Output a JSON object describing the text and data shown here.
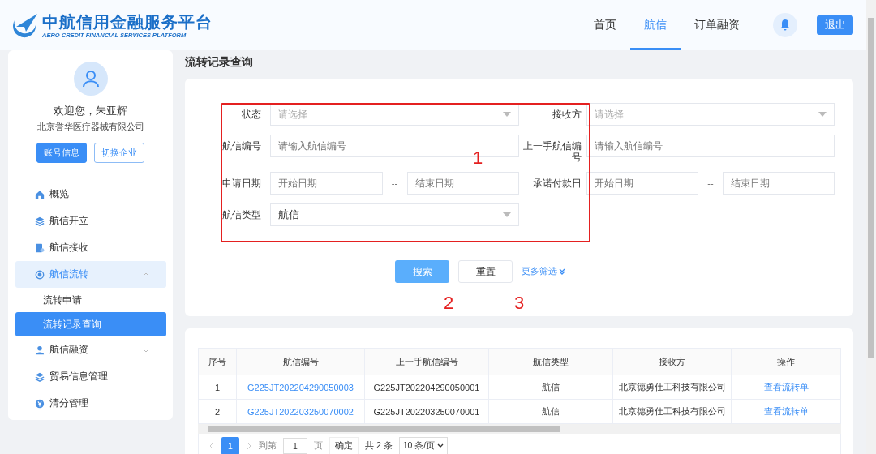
{
  "header": {
    "logo_title": "中航信用金融服务平台",
    "logo_subtitle": "AERO CREDIT FINANCIAL SERVICES PLATFORM",
    "nav": [
      {
        "label": "首页",
        "selected": false
      },
      {
        "label": "航信",
        "selected": true
      },
      {
        "label": "订单融资",
        "selected": false
      }
    ],
    "logout_button": "退出"
  },
  "sidebar": {
    "greeting": "欢迎您，朱亚辉",
    "company": "北京誉华医疗器械有限公司",
    "buttons": [
      {
        "label": "账号信息",
        "kind": "primary"
      },
      {
        "label": "切换企业",
        "kind": "outline"
      }
    ],
    "menu": [
      {
        "label": "概览",
        "kind": "home"
      },
      {
        "label": "航信开立",
        "kind": "layers"
      },
      {
        "label": "航信接收",
        "kind": "doc"
      },
      {
        "label": "航信流转",
        "kind": "ring",
        "expanded": true,
        "children": [
          {
            "label": "流转申请",
            "selected": false
          },
          {
            "label": "流转记录查询",
            "selected": true
          }
        ]
      },
      {
        "label": "航信融资",
        "kind": "person",
        "expanded": false
      },
      {
        "label": "贸易信息管理",
        "kind": "layers"
      },
      {
        "label": "清分管理",
        "kind": "coin"
      }
    ]
  },
  "page_title": "流转记录查询",
  "filters": {
    "fields": [
      {
        "label": "状态",
        "kind": "select",
        "placeholder": "请选择"
      },
      {
        "label": "接收方",
        "kind": "select",
        "placeholder": "请选择"
      },
      {
        "label": "航信编号",
        "kind": "input",
        "placeholder": "请输入航信编号"
      },
      {
        "label": "上一手航信编号",
        "kind": "input",
        "placeholder": "请输入航信编号"
      },
      {
        "label": "申请日期",
        "kind": "daterange",
        "start_placeholder": "开始日期",
        "separator": "--",
        "end_placeholder": "结束日期"
      },
      {
        "label": "承诺付款日",
        "kind": "daterange",
        "start_placeholder": "开始日期",
        "separator": "--",
        "end_placeholder": "结束日期"
      },
      {
        "label": "航信类型",
        "kind": "select",
        "value": "航信"
      }
    ],
    "search_button": "搜索",
    "reset_button": "重置",
    "more_filters": "更多筛选"
  },
  "annotations": [
    "1",
    "2",
    "3"
  ],
  "table": {
    "columns": [
      "序号",
      "航信编号",
      "上一手航信编号",
      "航信类型",
      "接收方",
      "操作"
    ],
    "rows": [
      {
        "index": "1",
        "code": "G225JT202204290050003",
        "previous_code": "G225JT202204290050001",
        "type": "航信",
        "receiver": "北京德勇仕工科技有限公司",
        "action": "查看流转单"
      },
      {
        "index": "2",
        "code": "G225JT202203250070002",
        "previous_code": "G225JT202203250070001",
        "type": "航信",
        "receiver": "北京德勇仕工科技有限公司",
        "action": "查看流转单"
      }
    ],
    "pagination": {
      "pages": [
        {
          "label": "1",
          "selected": true
        }
      ],
      "goto_label": "到第",
      "goto_value": "1",
      "page_unit": "页",
      "confirm_button": "确定",
      "total": "共 2 条",
      "page_size": "10 条/页"
    }
  }
}
